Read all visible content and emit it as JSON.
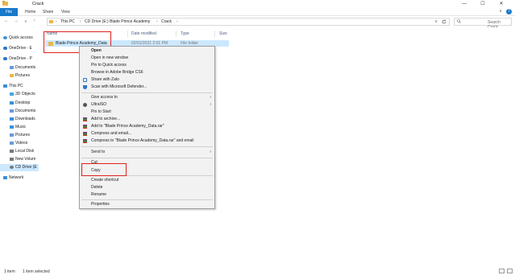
{
  "window": {
    "title": "Crack",
    "minimize": "—",
    "maximize": "☐",
    "close": "✕"
  },
  "ribbon": {
    "file": "File",
    "tabs": [
      "Home",
      "Share",
      "View"
    ],
    "help": "?",
    "collapse": "∨"
  },
  "nav": {
    "back": "←",
    "forward": "→",
    "up_arrow": "↑",
    "recent": "∨",
    "breadcrumbs": [
      "This PC",
      "CD Drive (E:) Blade Prince Academy",
      "Crack"
    ],
    "separator": "›",
    "search_placeholder": "Search Crack"
  },
  "sidebar": {
    "items": [
      {
        "label": "Quick access",
        "color": "#3b8fd8"
      },
      {
        "label": "OneDrive - E",
        "color": "#2f76c9"
      },
      {
        "label": "OneDrive - P",
        "color": "#2f76c9"
      },
      {
        "label": "Documents",
        "color": "#6b9ad6"
      },
      {
        "label": "Pictures",
        "color": "#e8b74a"
      },
      {
        "label": "This PC",
        "color": "#3b8fd8"
      },
      {
        "label": "3D Objects",
        "color": "#4aa3df"
      },
      {
        "label": "Desktop",
        "color": "#3b8fd8"
      },
      {
        "label": "Documents",
        "color": "#6b9ad6"
      },
      {
        "label": "Downloads",
        "color": "#3b8fd8"
      },
      {
        "label": "Music",
        "color": "#3b8fd8"
      },
      {
        "label": "Pictures",
        "color": "#6b9ad6"
      },
      {
        "label": "Videos",
        "color": "#6b9ad6"
      },
      {
        "label": "Local Disk",
        "color": "#777777"
      },
      {
        "label": "New Volum",
        "color": "#777777"
      },
      {
        "label": "CD Drive (E",
        "color": "#777777"
      },
      {
        "label": "Network",
        "color": "#3b8fd8"
      }
    ]
  },
  "columns": [
    "Name",
    "Date modified",
    "Type",
    "Size"
  ],
  "files": [
    {
      "name": "Blade Prince Academy_Data",
      "date": "02/01/2021 2:01 PM",
      "type": "File folder"
    }
  ],
  "context_menu": {
    "items": [
      "Open",
      "Open in new window",
      "Pin to Quick access",
      "Browse in Adobe Bridge CS6",
      "Share with Zalo",
      "Scan with Microsoft Defender...",
      "Give access to",
      "UltraISO",
      "Pin to Start",
      "Add to archive...",
      "Add to \"Blade Prince Academy_Data.rar\"",
      "Compress and email...",
      "Compress to \"Blade Prince Academy_Data.rar\" and email",
      "Send to",
      "Cut",
      "Copy",
      "Create shortcut",
      "Delete",
      "Rename",
      "Properties"
    ],
    "submenu_arrow": "›"
  },
  "status": {
    "count": "1 item",
    "selected": "1 item selected"
  },
  "colors": {
    "accent": "#1979ca",
    "selection": "#cce8ff",
    "highlight_box": "#e0201b"
  }
}
